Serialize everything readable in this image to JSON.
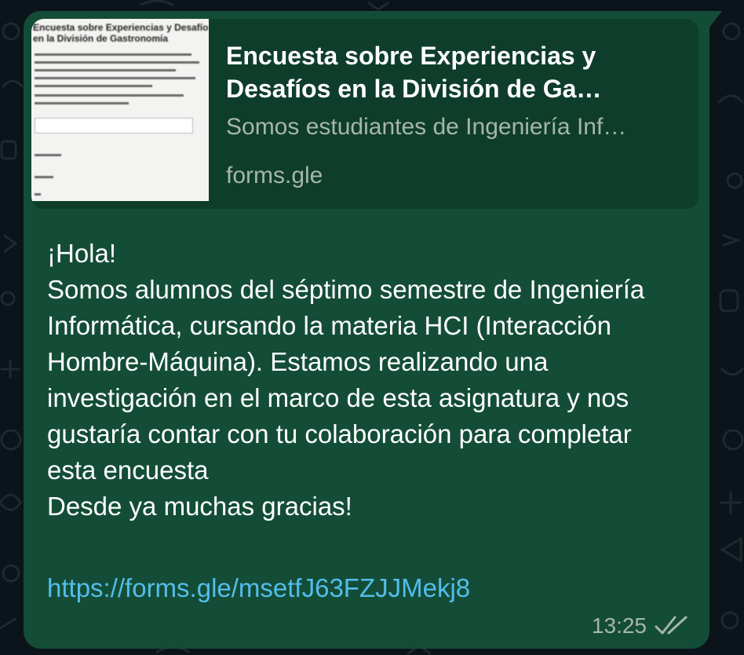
{
  "link_preview": {
    "thumbnail": {
      "title_line1": "Encuesta sobre Experiencias y Desafíos",
      "title_line2": "en la División de Gastronomía"
    },
    "title": "Encuesta sobre Experiencias y Desafíos en la División de Ga…",
    "description": "Somos estudiantes de Ingeniería Inf…",
    "domain": "forms.gle"
  },
  "message": {
    "body": "¡Hola!\nSomos alumnos del séptimo semestre de Ingeniería Informática, cursando la materia HCI (Interacción Hombre-Máquina). Estamos realizando una investigación en el marco de esta asignatura y nos gustaría contar con tu colaboración para completar esta encuesta\nDesde ya muchas gracias!",
    "link": "https://forms.gle/msetfJ63FZJJMekj8",
    "time": "13:25",
    "status_icon": "double-check-icon"
  },
  "colors": {
    "bubble": "#144d37",
    "preview_bg": "#0f3d2c",
    "link": "#53bdeb",
    "meta_text": "#a6b5ad",
    "wallpaper": "#0b141a"
  }
}
